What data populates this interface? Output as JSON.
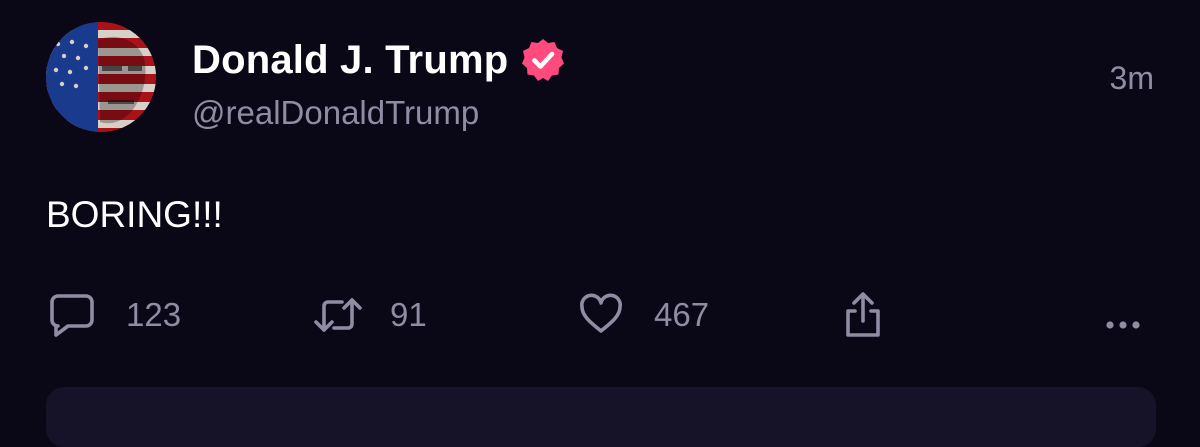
{
  "post": {
    "author_name": "Donald J. Trump",
    "handle": "@realDonaldTrump",
    "time": "3m",
    "text": "BORING!!!",
    "verified": true
  },
  "actions": {
    "reply_count": "123",
    "retruth_count": "91",
    "like_count": "467"
  },
  "colors": {
    "background": "#0a0716",
    "verified_badge": "#ff4a7d",
    "muted_text": "#8f8ca3",
    "primary_text": "#ffffff"
  },
  "icons": [
    "reply-icon",
    "retruth-icon",
    "heart-icon",
    "share-icon",
    "more-icon",
    "verified-badge-icon"
  ]
}
